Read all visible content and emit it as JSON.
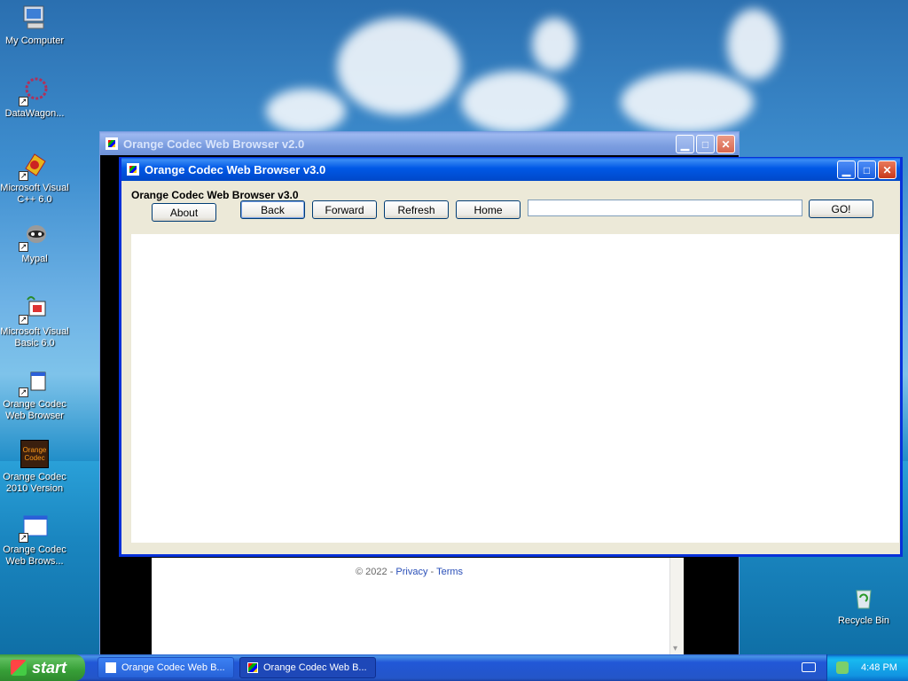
{
  "desktop": {
    "icons": [
      {
        "label": "My Computer"
      },
      {
        "label": "DataWagon..."
      },
      {
        "label": "Microsoft Visual C++ 6.0"
      },
      {
        "label": "Mypal"
      },
      {
        "label": "Microsoft Visual Basic 6.0"
      },
      {
        "label": "Orange Codec Web Browser"
      },
      {
        "label": "Orange Codec 2010 Version"
      },
      {
        "label": "Orange Codec Web Brows..."
      },
      {
        "label": "Recycle Bin"
      }
    ],
    "icon_tile_text": "Orange Codec"
  },
  "back_window": {
    "title": "Orange Codec Web Browser v2.0",
    "footer": {
      "copyright": "© 2022 -",
      "privacy": "Privacy",
      "separator": "-",
      "terms": "Terms"
    }
  },
  "main_window": {
    "title": "Orange Codec Web Browser v3.0",
    "heading": "Orange Codec Web Browser v3.0",
    "buttons": {
      "about": "About",
      "back": "Back",
      "forward": "Forward",
      "refresh": "Refresh",
      "home": "Home",
      "go": "GO!"
    },
    "address_value": ""
  },
  "taskbar": {
    "start_label": "start",
    "tasks": [
      {
        "label": "Orange Codec Web B..."
      },
      {
        "label": "Orange Codec Web B..."
      }
    ],
    "clock": "4:48 PM"
  },
  "colors": {
    "xp_blue": "#0054e3",
    "start_green": "#3c9a3c",
    "link": "#2a4fb8"
  }
}
